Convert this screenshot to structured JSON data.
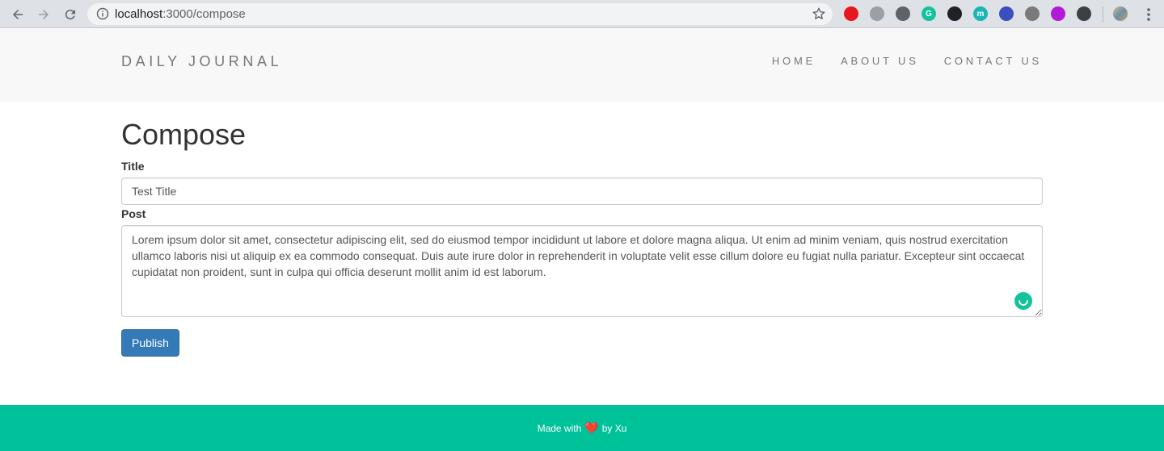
{
  "browser": {
    "url_host": "localhost",
    "url_rest": ":3000/compose",
    "extensions": [
      {
        "icon": "adblock-icon",
        "color": "#e8171d",
        "glyph": ""
      },
      {
        "icon": "network-icon",
        "color": "#9aa0a6",
        "glyph": ""
      },
      {
        "icon": "pocket-like-icon",
        "color": "#5f6368",
        "glyph": ""
      },
      {
        "icon": "grammarly-icon",
        "color": "#15c39a",
        "glyph": "G"
      },
      {
        "icon": "record-icon",
        "color": "#202124",
        "glyph": ""
      },
      {
        "icon": "m-circle-icon",
        "color": "#1ab5b5",
        "glyph": "m"
      },
      {
        "icon": "window-icon",
        "color": "#3c4fbf",
        "glyph": ""
      },
      {
        "icon": "bug-icon",
        "color": "#7a7a7a",
        "glyph": ""
      },
      {
        "icon": "code-icon",
        "color": "#b21bd6",
        "glyph": ""
      },
      {
        "icon": "shield-icon",
        "color": "#3c4043",
        "glyph": ""
      }
    ]
  },
  "header": {
    "brand": "DAILY JOURNAL",
    "nav": [
      "HOME",
      "ABOUT US",
      "CONTACT US"
    ]
  },
  "compose": {
    "heading": "Compose",
    "title_label": "Title",
    "title_value": "Test Title",
    "post_label": "Post",
    "post_value": "Lorem ipsum dolor sit amet, consectetur adipiscing elit, sed do eiusmod tempor incididunt ut labore et dolore magna aliqua. Ut enim ad minim veniam, quis nostrud exercitation ullamco laboris nisi ut aliquip ex ea commodo consequat. Duis aute irure dolor in reprehenderit in voluptate velit esse cillum dolore eu fugiat nulla pariatur. Excepteur sint occaecat cupidatat non proident, sunt in culpa qui officia deserunt mollit anim id est laborum.",
    "publish_label": "Publish"
  },
  "footer": {
    "text_before": "Made with",
    "heart": "❤️",
    "text_after": "by Xu"
  },
  "colors": {
    "header_bg": "#f8f8f8",
    "primary_button": "#337ab7",
    "footer_bg": "#00c29a"
  }
}
